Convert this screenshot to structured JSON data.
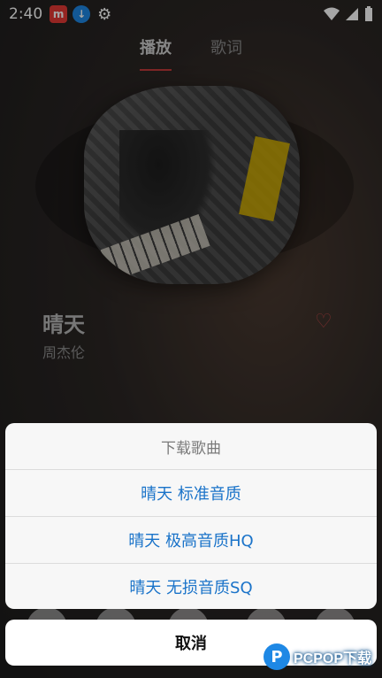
{
  "status": {
    "time": "2:40",
    "icons": [
      "app-icon-red",
      "download-icon",
      "gear-icon",
      "wifi-icon",
      "signal-icon",
      "battery-icon"
    ]
  },
  "tabs": [
    {
      "label": "播放",
      "active": true
    },
    {
      "label": "歌词",
      "active": false
    }
  ],
  "song": {
    "title": "晴天",
    "artist": "周杰伦"
  },
  "dialog": {
    "title": "下载歌曲",
    "options": [
      {
        "label": "晴天 标准音质"
      },
      {
        "label": "晴天 极高音质HQ"
      },
      {
        "label": "晴天 无损音质SQ"
      }
    ],
    "cancel_label": "取消"
  },
  "watermark": {
    "logo_letter": "P",
    "text": "PCPOP下载"
  },
  "colors": {
    "accent_red": "#c23a3a",
    "option_blue": "#1a73c9"
  }
}
